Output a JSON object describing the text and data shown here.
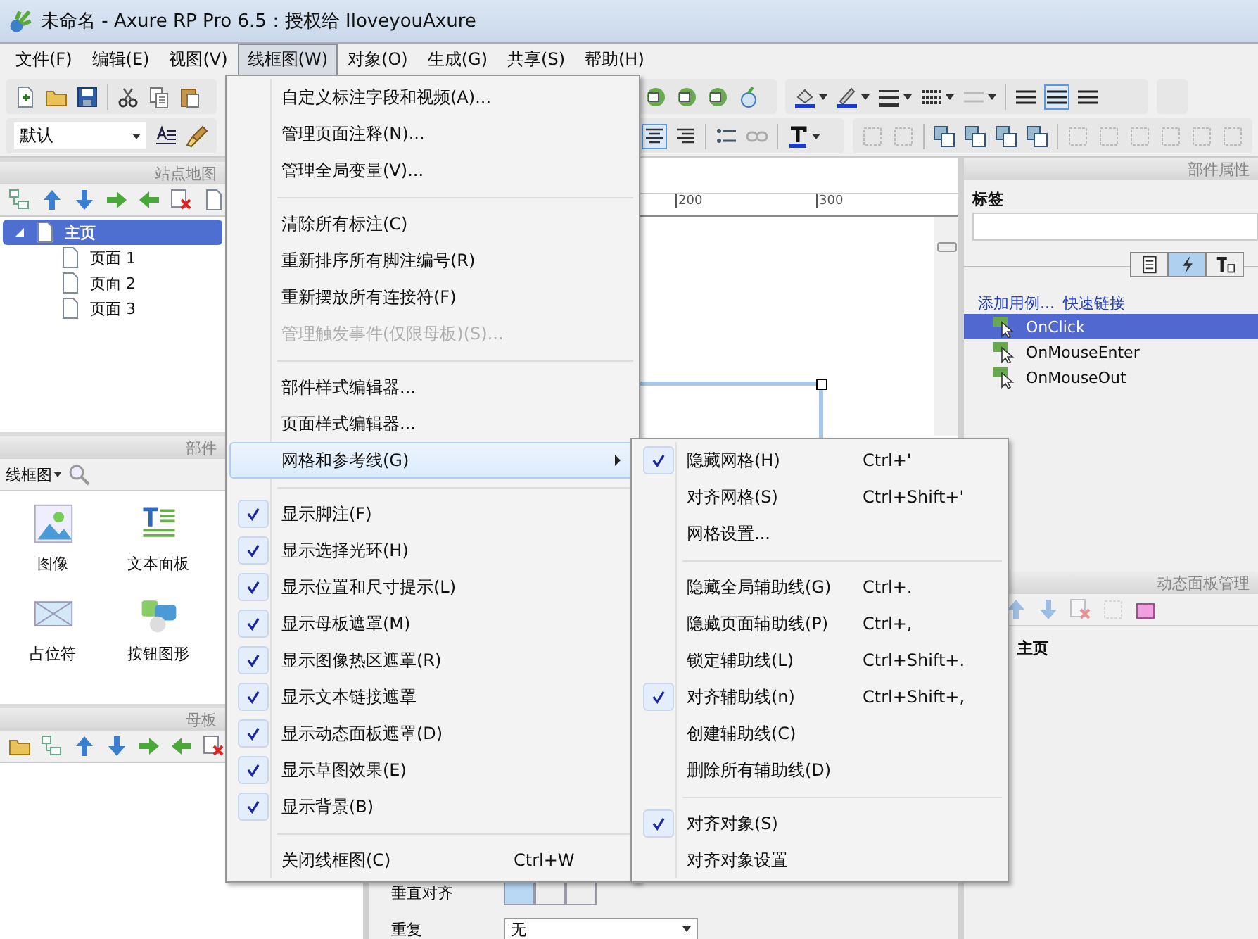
{
  "window": {
    "title": "未命名 - Axure RP Pro 6.5：授权给 IloveyouAxure"
  },
  "menu_bar": [
    {
      "label": "文件(F)",
      "selected": false
    },
    {
      "label": "编辑(E)",
      "selected": false
    },
    {
      "label": "视图(V)",
      "selected": false
    },
    {
      "label": "线框图(W)",
      "selected": true
    },
    {
      "label": "对象(O)",
      "selected": false
    },
    {
      "label": "生成(G)",
      "selected": false
    },
    {
      "label": "共享(S)",
      "selected": false
    },
    {
      "label": "帮助(H)",
      "selected": false
    }
  ],
  "toolbar": {
    "style_dropdown": "默认"
  },
  "sitemap": {
    "title": "站点地图",
    "tree": [
      {
        "label": "主页",
        "selected": true,
        "expanded": true,
        "children": [
          {
            "label": "页面 1",
            "selected": false
          },
          {
            "label": "页面 2",
            "selected": false
          },
          {
            "label": "页面 3",
            "selected": false
          }
        ]
      }
    ]
  },
  "widgets": {
    "title": "部件",
    "library": "线框图",
    "items": [
      {
        "label": "图像",
        "kind": "image"
      },
      {
        "label": "文本面板",
        "kind": "text"
      },
      {
        "label": "占位符",
        "kind": "placeholder"
      },
      {
        "label": "按钮图形",
        "kind": "button"
      }
    ]
  },
  "masters": {
    "title": "母板"
  },
  "canvas": {
    "ruler_labels": [
      "200",
      "300"
    ],
    "vertical_align_label": "垂直对齐",
    "repeat_label": "重复",
    "repeat_value": "无"
  },
  "properties": {
    "title": "部件属性",
    "label_heading": "标签",
    "tabs": [
      {
        "kind": "notes",
        "selected": false
      },
      {
        "kind": "interactions",
        "selected": true
      },
      {
        "kind": "format",
        "selected": false
      }
    ],
    "links": [
      "添加用例...",
      "快速链接"
    ],
    "events": [
      {
        "label": "OnClick",
        "selected": true
      },
      {
        "label": "OnMouseEnter",
        "selected": false
      },
      {
        "label": "OnMouseOut",
        "selected": false
      }
    ]
  },
  "dynamic_panels": {
    "title": "动态面板管理",
    "items": [
      "主页"
    ]
  },
  "menu": {
    "items": [
      {
        "kind": "item",
        "label": "自定义标注字段和视频(A)...",
        "checked": false,
        "disabled": false,
        "selected": false
      },
      {
        "kind": "item",
        "label": "管理页面注释(N)...",
        "checked": false,
        "disabled": false,
        "selected": false
      },
      {
        "kind": "item",
        "label": "管理全局变量(V)...",
        "checked": false,
        "disabled": false,
        "selected": false
      },
      {
        "kind": "separator"
      },
      {
        "kind": "item",
        "label": "清除所有标注(C)",
        "checked": false,
        "disabled": false,
        "selected": false
      },
      {
        "kind": "item",
        "label": "重新排序所有脚注编号(R)",
        "checked": false,
        "disabled": false,
        "selected": false
      },
      {
        "kind": "item",
        "label": "重新摆放所有连接符(F)",
        "checked": false,
        "disabled": false,
        "selected": false
      },
      {
        "kind": "item",
        "label": "管理触发事件(仅限母板)(S)...",
        "checked": false,
        "disabled": true,
        "selected": false
      },
      {
        "kind": "separator"
      },
      {
        "kind": "item",
        "label": "部件样式编辑器...",
        "checked": false,
        "disabled": false,
        "selected": false
      },
      {
        "kind": "item",
        "label": "页面样式编辑器...",
        "checked": false,
        "disabled": false,
        "selected": false
      },
      {
        "kind": "submenu",
        "label": "网格和参考线(G)",
        "checked": false,
        "disabled": false,
        "selected": true
      },
      {
        "kind": "separator"
      },
      {
        "kind": "item",
        "label": "显示脚注(F)",
        "checked": true,
        "disabled": false,
        "selected": false
      },
      {
        "kind": "item",
        "label": "显示选择光环(H)",
        "checked": true,
        "disabled": false,
        "selected": false
      },
      {
        "kind": "item",
        "label": "显示位置和尺寸提示(L)",
        "checked": true,
        "disabled": false,
        "selected": false
      },
      {
        "kind": "item",
        "label": "显示母板遮罩(M)",
        "checked": true,
        "disabled": false,
        "selected": false
      },
      {
        "kind": "item",
        "label": "显示图像热区遮罩(R)",
        "checked": true,
        "disabled": false,
        "selected": false
      },
      {
        "kind": "item",
        "label": "显示文本链接遮罩",
        "checked": true,
        "disabled": false,
        "selected": false
      },
      {
        "kind": "item",
        "label": "显示动态面板遮罩(D)",
        "checked": true,
        "disabled": false,
        "selected": false
      },
      {
        "kind": "item",
        "label": "显示草图效果(E)",
        "checked": true,
        "disabled": false,
        "selected": false
      },
      {
        "kind": "item",
        "label": "显示背景(B)",
        "checked": true,
        "disabled": false,
        "selected": false
      },
      {
        "kind": "separator"
      },
      {
        "kind": "item",
        "label": "关闭线框图(C)",
        "shortcut": "Ctrl+W",
        "checked": false,
        "disabled": false,
        "selected": false
      }
    ]
  },
  "submenu": {
    "items": [
      {
        "kind": "item",
        "label": "隐藏网格(H)",
        "shortcut": "Ctrl+'",
        "checked": true
      },
      {
        "kind": "item",
        "label": "对齐网格(S)",
        "shortcut": "Ctrl+Shift+'",
        "checked": false
      },
      {
        "kind": "item",
        "label": "网格设置...",
        "checked": false
      },
      {
        "kind": "separator"
      },
      {
        "kind": "item",
        "label": "隐藏全局辅助线(G)",
        "shortcut": "Ctrl+.",
        "checked": false
      },
      {
        "kind": "item",
        "label": "隐藏页面辅助线(P)",
        "shortcut": "Ctrl+,",
        "checked": false
      },
      {
        "kind": "item",
        "label": "锁定辅助线(L)",
        "shortcut": "Ctrl+Shift+.",
        "checked": false
      },
      {
        "kind": "item",
        "label": "对齐辅助线(n)",
        "shortcut": "Ctrl+Shift+,",
        "checked": true
      },
      {
        "kind": "item",
        "label": "创建辅助线(C)",
        "checked": false
      },
      {
        "kind": "item",
        "label": "删除所有辅助线(D)",
        "checked": false
      },
      {
        "kind": "separator"
      },
      {
        "kind": "item",
        "label": "对齐对象(S)",
        "checked": true
      },
      {
        "kind": "item",
        "label": "对齐对象设置",
        "checked": false
      }
    ]
  }
}
